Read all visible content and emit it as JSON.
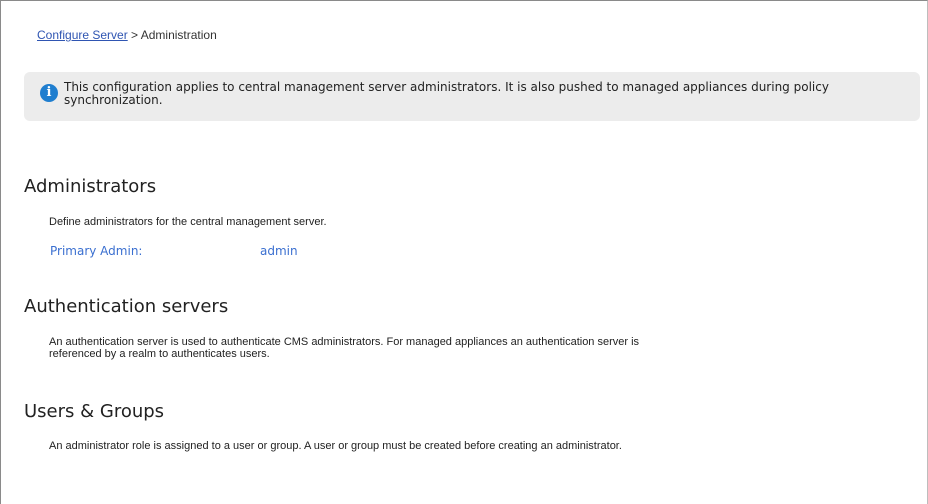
{
  "breadcrumb": {
    "link": "Configure Server",
    "separator": " > ",
    "current": "Administration"
  },
  "info_banner": {
    "icon": "info-icon",
    "icon_glyph": "i",
    "text": "This configuration applies to central management server administrators. It is also pushed to managed appliances during policy synchronization."
  },
  "sections": {
    "administrators": {
      "title": "Administrators",
      "description": "Define administrators for the central management server.",
      "primary_admin_label": "Primary Admin:",
      "primary_admin_value": "admin"
    },
    "auth_servers": {
      "title": "Authentication servers",
      "description": "An authentication server is used to authenticate CMS administrators. For managed appliances an authentication server is referenced by a realm to authenticates users."
    },
    "users_groups": {
      "title": "Users & Groups",
      "description": "An administrator role is assigned to a user or group. A user or group must be created before creating an administrator."
    }
  },
  "colors": {
    "link": "#2f55b2",
    "field": "#3a6fd0",
    "banner_bg": "#ececec",
    "info_icon": "#1f7ecf"
  }
}
